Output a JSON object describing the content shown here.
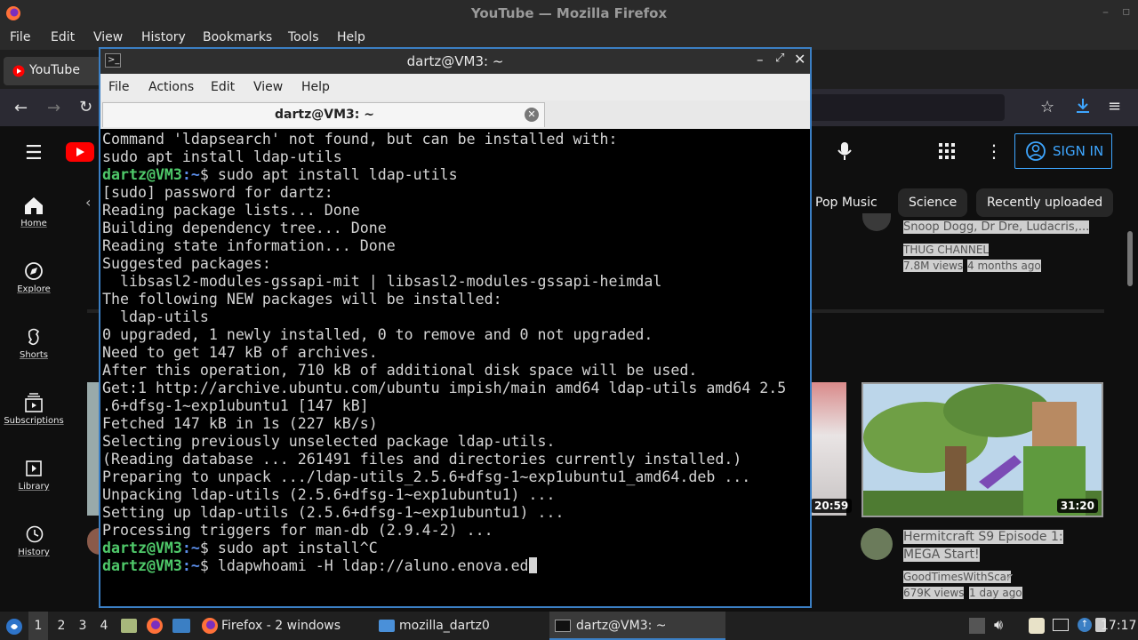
{
  "firefox": {
    "title": "YouTube — Mozilla Firefox",
    "menu": [
      "File",
      "Edit",
      "View",
      "History",
      "Bookmarks",
      "Tools",
      "Help"
    ],
    "tab_label": "YouTube"
  },
  "youtube": {
    "sign_in": "SIGN IN",
    "sidebar": [
      {
        "label": "Home",
        "icon": "home-icon"
      },
      {
        "label": "Explore",
        "icon": "compass-icon"
      },
      {
        "label": "Shorts",
        "icon": "shorts-icon"
      },
      {
        "label": "Subscriptions",
        "icon": "subscriptions-icon"
      },
      {
        "label": "Library",
        "icon": "library-icon"
      },
      {
        "label": "History",
        "icon": "history-icon"
      }
    ],
    "chips": [
      "Pop Music",
      "Science",
      "Recently uploaded"
    ],
    "video_top": {
      "title": "Snoop Dogg, Dr Dre, Ludacris,...",
      "channel": "THUG CHANNEL",
      "views": "7.8M views",
      "age": "4 months ago"
    },
    "video_main": {
      "title_line1": "Hermitcraft S9 Episode 1:",
      "title_line2": "MEGA Start!",
      "channel": "GoodTimesWithScar",
      "views": "679K views",
      "age": "1 day ago",
      "duration": "31:20"
    },
    "video_left_duration": "20:59"
  },
  "terminal": {
    "title": "dartz@VM3: ~",
    "tab_title": "dartz@VM3: ~",
    "menu": [
      "File",
      "Actions",
      "Edit",
      "View",
      "Help"
    ],
    "prompt_user": "dartz@VM3",
    "prompt_path": ":~",
    "lines": [
      {
        "type": "out",
        "text": "Command 'ldapsearch' not found, but can be installed with:"
      },
      {
        "type": "out",
        "text": "sudo apt install ldap-utils"
      },
      {
        "type": "cmd",
        "text": "$ sudo apt install ldap-utils"
      },
      {
        "type": "out",
        "text": "[sudo] password for dartz:"
      },
      {
        "type": "out",
        "text": "Reading package lists... Done"
      },
      {
        "type": "out",
        "text": "Building dependency tree... Done"
      },
      {
        "type": "out",
        "text": "Reading state information... Done"
      },
      {
        "type": "out",
        "text": "Suggested packages:"
      },
      {
        "type": "out",
        "text": "  libsasl2-modules-gssapi-mit | libsasl2-modules-gssapi-heimdal"
      },
      {
        "type": "out",
        "text": "The following NEW packages will be installed:"
      },
      {
        "type": "out",
        "text": "  ldap-utils"
      },
      {
        "type": "out",
        "text": "0 upgraded, 1 newly installed, 0 to remove and 0 not upgraded."
      },
      {
        "type": "out",
        "text": "Need to get 147 kB of archives."
      },
      {
        "type": "out",
        "text": "After this operation, 710 kB of additional disk space will be used."
      },
      {
        "type": "out",
        "text": "Get:1 http://archive.ubuntu.com/ubuntu impish/main amd64 ldap-utils amd64 2.5"
      },
      {
        "type": "out",
        "text": ".6+dfsg-1~exp1ubuntu1 [147 kB]"
      },
      {
        "type": "out",
        "text": "Fetched 147 kB in 1s (227 kB/s)"
      },
      {
        "type": "out",
        "text": "Selecting previously unselected package ldap-utils."
      },
      {
        "type": "out",
        "text": "(Reading database ... 261491 files and directories currently installed.)"
      },
      {
        "type": "out",
        "text": "Preparing to unpack .../ldap-utils_2.5.6+dfsg-1~exp1ubuntu1_amd64.deb ..."
      },
      {
        "type": "out",
        "text": "Unpacking ldap-utils (2.5.6+dfsg-1~exp1ubuntu1) ..."
      },
      {
        "type": "out",
        "text": "Setting up ldap-utils (2.5.6+dfsg-1~exp1ubuntu1) ..."
      },
      {
        "type": "out",
        "text": "Processing triggers for man-db (2.9.4-2) ..."
      },
      {
        "type": "cmd",
        "text": "$ sudo apt install^C"
      },
      {
        "type": "cmd",
        "text": "$ ldapwhoami -H ldap://aluno.enova.ed",
        "cursor": true
      }
    ]
  },
  "taskbar": {
    "workspaces": [
      "1",
      "2",
      "3",
      "4"
    ],
    "tasks": [
      "Firefox - 2 windows",
      "mozilla_dartz0",
      "dartz@VM3: ~"
    ],
    "clock": "17:17"
  },
  "colors": {
    "terminal_border": "#3b7fc4",
    "prompt_user": "#4fc96a",
    "prompt_path": "#5b8de8",
    "yt_red": "#ff0000",
    "sign_in_blue": "#3ea6ff"
  }
}
